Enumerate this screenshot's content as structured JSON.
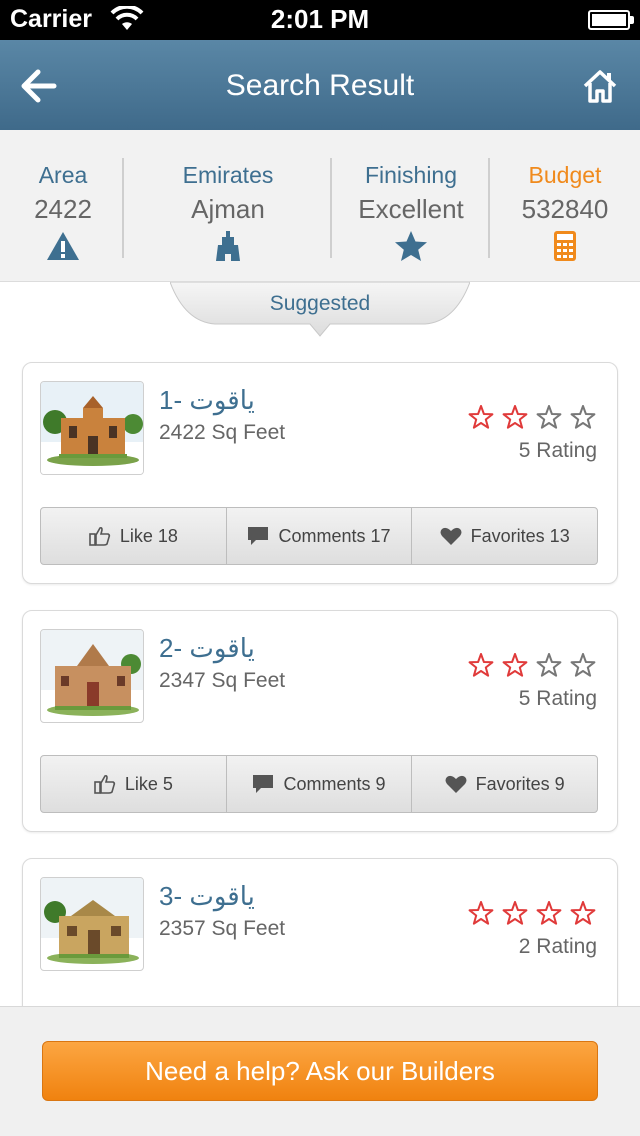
{
  "status_bar": {
    "carrier": "Carrier",
    "time": "2:01 PM"
  },
  "nav": {
    "title": "Search Result",
    "back_icon": "back-arrow-icon",
    "home_icon": "home-icon"
  },
  "filters": [
    {
      "label": "Area",
      "value": "2422",
      "icon": "warning-icon"
    },
    {
      "label": "Emirates",
      "value": "Ajman",
      "icon": "building-icon"
    },
    {
      "label": "Finishing",
      "value": "Excellent",
      "icon": "star-icon"
    },
    {
      "label": "Budget",
      "value": "532840",
      "icon": "calculator-icon"
    }
  ],
  "suggested_label": "Suggested",
  "results": [
    {
      "name": "ياقوت -1",
      "size": "2422 Sq Feet",
      "stars": 2,
      "max_stars": 4,
      "rating": "5 Rating",
      "like": "Like 18",
      "comments": "Comments 17",
      "favorites": "Favorites 13"
    },
    {
      "name": "ياقوت -2",
      "size": "2347 Sq Feet",
      "stars": 2,
      "max_stars": 4,
      "rating": "5 Rating",
      "like": "Like 5",
      "comments": "Comments 9",
      "favorites": "Favorites 9"
    },
    {
      "name": "ياقوت -3",
      "size": "2357 Sq Feet",
      "stars": 4,
      "max_stars": 4,
      "rating": "2 Rating"
    }
  ],
  "footer": {
    "help_button": "Need a help? Ask our Builders"
  },
  "colors": {
    "nav": "#4a7698",
    "accent": "#f08a1c",
    "label": "#3e6f90",
    "star": "#e03a3a"
  }
}
